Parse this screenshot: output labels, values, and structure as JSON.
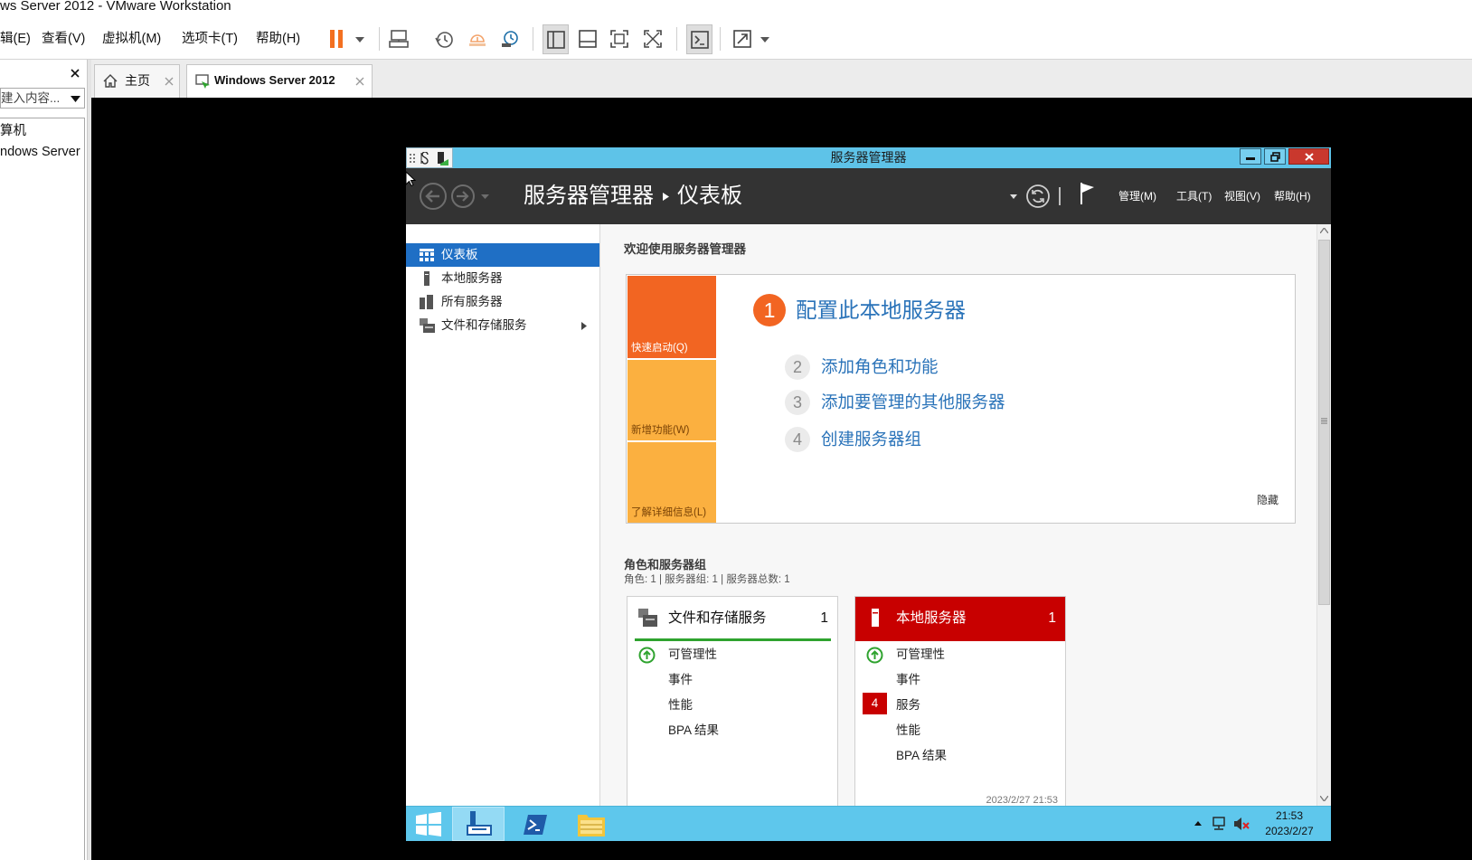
{
  "app": {
    "title": "ws Server 2012 - VMware Workstation"
  },
  "menu": [
    {
      "label": "辑(E)"
    },
    {
      "label": "查看(V)"
    },
    {
      "label": "虚拟机(M)"
    },
    {
      "label": "选项卡(T)"
    },
    {
      "label": "帮助(H)"
    }
  ],
  "toolbar": {
    "icons": [
      "pause-icon",
      "send-ctrl-alt-del-icon",
      "snapshot-icon",
      "revert-snapshot-icon",
      "snapshot-manager-icon",
      "show-library-icon",
      "thumbnail-bar-icon",
      "full-screen-icon",
      "unity-icon",
      "console-view-icon",
      "stretch-guest-icon"
    ]
  },
  "library": {
    "search_placeholder": "建入内容...",
    "tree": [
      {
        "label": "算机"
      },
      {
        "label": "ndows Server"
      }
    ]
  },
  "tabs": [
    {
      "label": "主页",
      "icon": "home-icon",
      "active": false
    },
    {
      "label": "Windows Server 2012",
      "icon": "vm-icon",
      "active": true
    }
  ],
  "server_manager": {
    "window_title": "服务器管理器",
    "breadcrumb": {
      "root": "服务器管理器",
      "page": "仪表板"
    },
    "menus": [
      {
        "label": "管理(M)"
      },
      {
        "label": "工具(T)"
      },
      {
        "label": "视图(V)"
      },
      {
        "label": "帮助(H)"
      }
    ],
    "nav": [
      {
        "label": "仪表板",
        "icon": "dashboard-icon",
        "selected": true
      },
      {
        "label": "本地服务器",
        "icon": "local-server-icon",
        "selected": false
      },
      {
        "label": "所有服务器",
        "icon": "all-servers-icon",
        "selected": false
      },
      {
        "label": "文件和存储服务",
        "icon": "file-storage-icon",
        "selected": false
      }
    ],
    "welcome": {
      "heading": "欢迎使用服务器管理器",
      "tiles": [
        {
          "label": "快速启动(Q)"
        },
        {
          "label": "新增功能(W)"
        },
        {
          "label": "了解详细信息(L)"
        }
      ],
      "primary_step": {
        "number": "1",
        "label": "配置此本地服务器"
      },
      "steps": [
        {
          "number": "2",
          "label": "添加角色和功能"
        },
        {
          "number": "3",
          "label": "添加要管理的其他服务器"
        },
        {
          "number": "4",
          "label": "创建服务器组"
        }
      ],
      "hide_label": "隐藏"
    },
    "roles": {
      "heading": "角色和服务器组",
      "summary": "角色: 1 | 服务器组: 1 | 服务器总数: 1",
      "cards": [
        {
          "title": "文件和存储服务",
          "count": "1",
          "rows": [
            {
              "label": "可管理性",
              "icon": "ok-status-icon"
            },
            {
              "label": "事件"
            },
            {
              "label": "性能"
            },
            {
              "label": "BPA 结果"
            }
          ]
        },
        {
          "title": "本地服务器",
          "count": "1",
          "rows": [
            {
              "label": "可管理性",
              "icon": "ok-status-icon"
            },
            {
              "label": "事件"
            },
            {
              "label": "服务",
              "alert_count": "4"
            },
            {
              "label": "性能"
            },
            {
              "label": "BPA 结果"
            }
          ],
          "timestamp": "2023/2/27 21:53"
        }
      ]
    }
  },
  "taskbar": {
    "time": "21:53",
    "date": "2023/2/27"
  },
  "colors": {
    "vmware_accent": "#f37021",
    "sm_titlebar": "#5ec3e8",
    "sm_header": "#333333",
    "nav_selected": "#1f6fc5",
    "tile_primary": "#f26522",
    "tile_secondary": "#fbb040",
    "link_blue": "#2a73b9",
    "card_alert": "#c80000",
    "status_ok": "#2fa32f",
    "taskbar": "#5ec7ec"
  }
}
